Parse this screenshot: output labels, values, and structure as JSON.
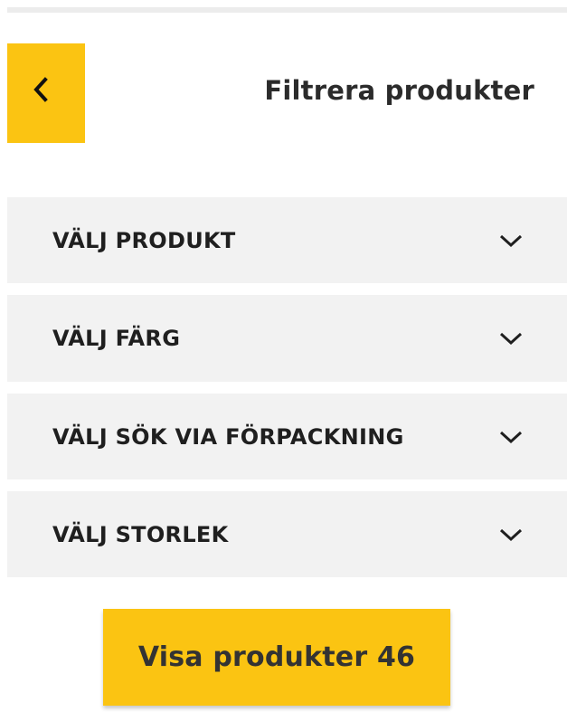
{
  "header": {
    "title": "Filtrera produkter",
    "back_icon": "chevron-left-icon",
    "accent_color": "#fbc412"
  },
  "filters": [
    {
      "label": "VÄLJ PRODUKT",
      "icon": "chevron-down-icon"
    },
    {
      "label": "VÄLJ FÄRG",
      "icon": "chevron-down-icon"
    },
    {
      "label": "VÄLJ SÖK VIA FÖRPACKNING",
      "icon": "chevron-down-icon"
    },
    {
      "label": "VÄLJ STORLEK",
      "icon": "chevron-down-icon"
    }
  ],
  "footer": {
    "show_button_label": "Visa produkter 46"
  }
}
